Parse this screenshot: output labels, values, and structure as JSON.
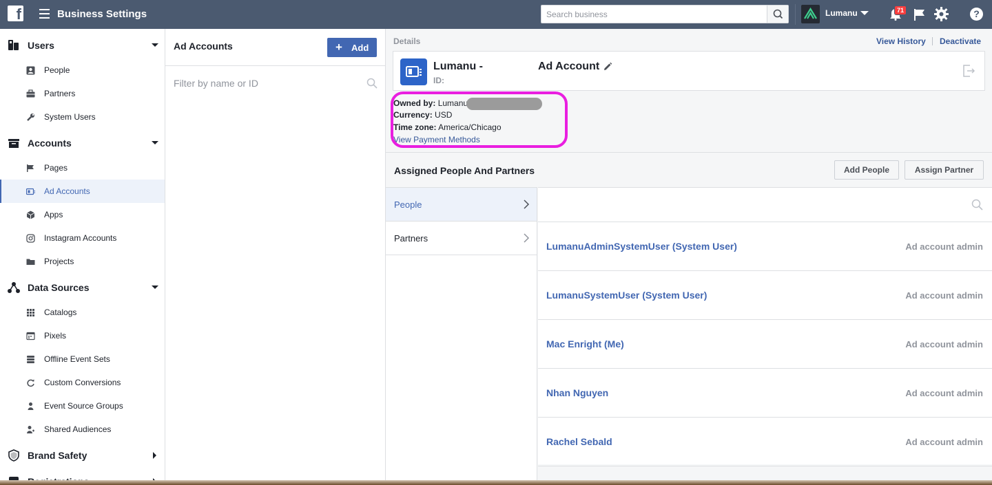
{
  "topbar": {
    "logo": "f",
    "title": "Business Settings",
    "search_placeholder": "Search business",
    "business_name": "Lumanu",
    "notification_count": "71",
    "help_glyph": "?"
  },
  "sidebar": {
    "sections": [
      {
        "label": "Users",
        "icon": "users-icon"
      },
      {
        "label": "Accounts",
        "icon": "accounts-icon"
      },
      {
        "label": "Data Sources",
        "icon": "data-sources-icon"
      },
      {
        "label": "Brand Safety",
        "icon": "shield-icon"
      },
      {
        "label": "Registrations",
        "icon": "registrations-icon"
      }
    ],
    "items": [
      {
        "label": "People",
        "icon": "person-icon"
      },
      {
        "label": "Partners",
        "icon": "briefcase-icon"
      },
      {
        "label": "System Users",
        "icon": "wrench-icon"
      },
      {
        "label": "Pages",
        "icon": "flag-icon"
      },
      {
        "label": "Ad Accounts",
        "icon": "ad-account-icon"
      },
      {
        "label": "Apps",
        "icon": "cube-icon"
      },
      {
        "label": "Instagram Accounts",
        "icon": "instagram-icon"
      },
      {
        "label": "Projects",
        "icon": "folder-icon"
      },
      {
        "label": "Catalogs",
        "icon": "grid-icon"
      },
      {
        "label": "Pixels",
        "icon": "pixel-icon"
      },
      {
        "label": "Offline Event Sets",
        "icon": "stack-icon"
      },
      {
        "label": "Custom Conversions",
        "icon": "refresh-icon"
      },
      {
        "label": "Event Source Groups",
        "icon": "group-icon"
      },
      {
        "label": "Shared Audiences",
        "icon": "audience-icon"
      }
    ],
    "active_item": "Ad Accounts"
  },
  "middle": {
    "title": "Ad Accounts",
    "add_label": "Add",
    "filter_placeholder": "Filter by name or ID"
  },
  "details": {
    "header_label": "Details",
    "view_history": "View History",
    "deactivate": "Deactivate",
    "account_name": "Lumanu -",
    "account_type": "Ad Account",
    "id_label": "ID:",
    "owned_by_label": "Owned by:",
    "owned_by_value": "Lumanu",
    "currency_label": "Currency:",
    "currency_value": "USD",
    "timezone_label": "Time zone:",
    "timezone_value": "America/Chicago",
    "payment_link": "View Payment Methods",
    "highlight_color": "#e91ee0"
  },
  "assigned": {
    "title": "Assigned People And Partners",
    "add_people": "Add People",
    "assign_partner": "Assign Partner",
    "tabs": [
      {
        "label": "People",
        "active": true
      },
      {
        "label": "Partners",
        "active": false
      }
    ],
    "people": [
      {
        "name": "LumanuAdminSystemUser (System User)",
        "role": "Ad account admin"
      },
      {
        "name": "LumanuSystemUser (System User)",
        "role": "Ad account admin"
      },
      {
        "name": "Mac Enright (Me)",
        "role": "Ad account admin"
      },
      {
        "name": "Nhan Nguyen",
        "role": "Ad account admin"
      },
      {
        "name": "Rachel Sebald",
        "role": "Ad account admin"
      }
    ]
  },
  "colors": {
    "topbar": "#4b5a70",
    "accent": "#4267b2",
    "link": "#365899"
  }
}
